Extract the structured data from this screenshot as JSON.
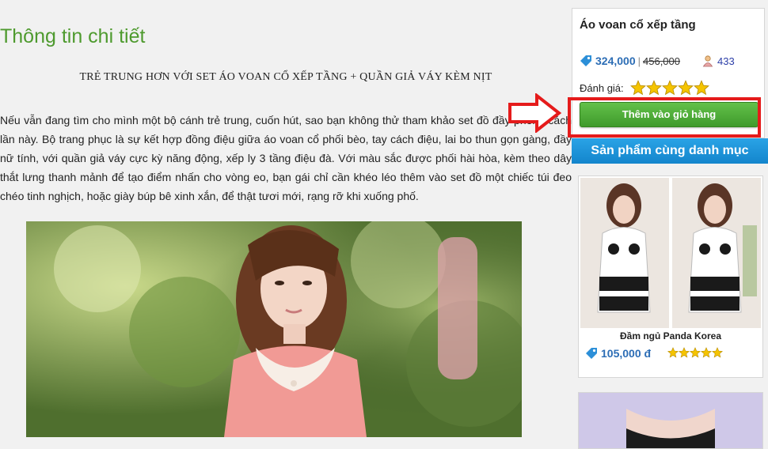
{
  "main": {
    "section_title": "Thông tin chi tiết",
    "subtitle": "TRẺ TRUNG HƠN VỚI SET ÁO VOAN CỔ XẾP TẦNG + QUẦN GIẢ VÁY KÈM NỊT",
    "description": "Nếu vẫn đang tìm cho mình một bộ cánh trẻ trung, cuốn hút, sao bạn không thử tham khảo set đồ đầy phong cách lần này. Bộ trang phục là sự kết hợp đồng điệu giữa áo voan cổ phối bèo, tay cách điệu, lai bo thun gọn gàng, đầy nữ tính, với quần giả váy cực kỳ năng động, xếp ly 3 tầng điệu đà. Với màu sắc được phối hài hòa, kèm theo dây thắt lưng thanh mảnh để tạo điểm nhấn cho vòng eo, bạn gái chỉ cần khéo léo thêm vào set đồ một chiếc túi đeo chéo tinh nghịch, hoặc giày búp bê xinh xắn, để thật tươi mới, rạng rỡ khi xuống phố."
  },
  "sidebar": {
    "product_name": "Áo voan cổ xếp tầng",
    "price": "324,000",
    "separator": "|",
    "old_price": "456,000",
    "view_count": "433",
    "rating_label": "Đánh giá:",
    "rating_stars": 5,
    "add_to_cart_label": "Thêm vào giỏ hàng",
    "related_header": "Sản phẩm cùng danh mục",
    "related": [
      {
        "name": "Đầm ngủ Panda Korea",
        "price": "105,000 đ",
        "stars": 5
      }
    ]
  },
  "colors": {
    "title_green": "#4e9a2e",
    "price_blue": "#2c6db5",
    "cart_green": "#4caf3a",
    "header_blue": "#1a92d8",
    "highlight_red": "#e51b1b",
    "star_gold": "#f5c400"
  },
  "icons": [
    "price-tag-icon",
    "user-views-icon",
    "star-icon",
    "right-arrow-icon"
  ]
}
